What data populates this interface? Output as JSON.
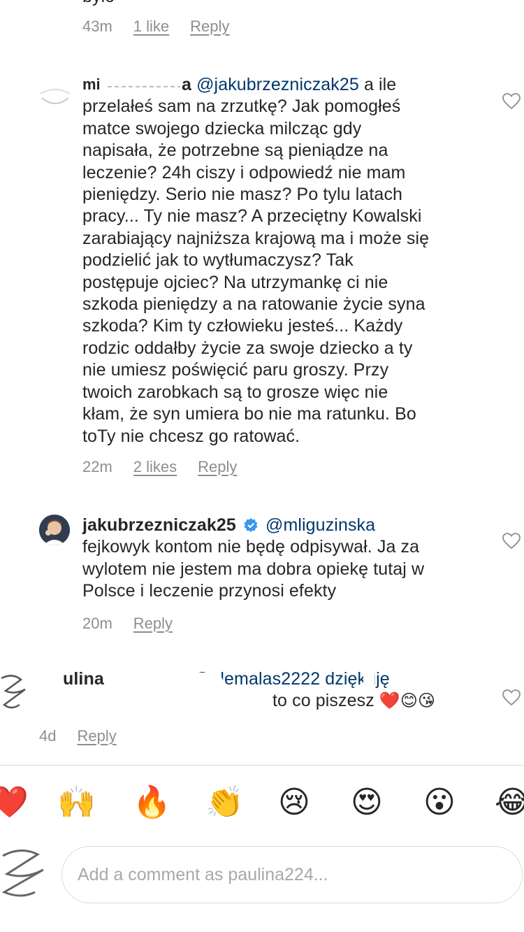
{
  "top_comment": {
    "partial_text": "było",
    "time": "43m",
    "likes": "1 like",
    "reply": "Reply"
  },
  "comment1": {
    "username_partial": "a",
    "mention": "@jakubrzezniczak25",
    "line1_after": " a ile",
    "lines": [
      "przelałeś sam na zrzutkę? Jak pomogłeś",
      "matce swojego dziecka milcząc gdy",
      "napisała, że potrzebne są pieniądze na",
      "leczenie? 24h ciszy i odpowiedź nie mam",
      "pieniędzy. Serio nie masz? Po tylu latach",
      "pracy... Ty nie masz? A przeciętny Kowalski",
      "zarabiający najniższa krajową ma i może się",
      "podzielić jak to wytłumaczysz? Tak",
      "postępuje ojciec? Na utrzymankę ci nie",
      "szkoda pieniędzy a na ratowanie życie syna",
      "szkoda? Kim ty człowieku jesteś... Każdy",
      "rodzic oddałby życie za swoje dziecko a ty",
      "nie umiesz poświęcić paru groszy. Przy",
      "twoich zarobkach są to grosze więc nie",
      "kłam, że syn umiera bo nie ma ratunku. Bo",
      "toTy nie chcesz go ratować."
    ],
    "time": "22m",
    "likes": "2 likes",
    "reply": "Reply"
  },
  "comment2": {
    "username": "jakubrzezniczak25",
    "mention": "@mliguzinska",
    "lines": [
      "fejkowyk kontom nie będę odpisywał. Ja za",
      "wylotem nie jestem ma dobra opiekę tutaj w",
      "Polsce i leczenie przynosi efekty"
    ],
    "time": "20m",
    "reply": "Reply"
  },
  "comment3": {
    "line1_fragment_a": "ulina",
    "line1_fragment_b": "@olemalas2222 dziękuję",
    "line2_fragment": "to co piszesz",
    "emojis": "❤️😊😘",
    "time": "4d",
    "reply": "Reply"
  },
  "reactions": [
    "❤️",
    "🙌",
    "🔥",
    "👏",
    "😢",
    "😍",
    "😮",
    "😂"
  ],
  "comment_input": {
    "placeholder": "Add a comment as paulina224..."
  }
}
